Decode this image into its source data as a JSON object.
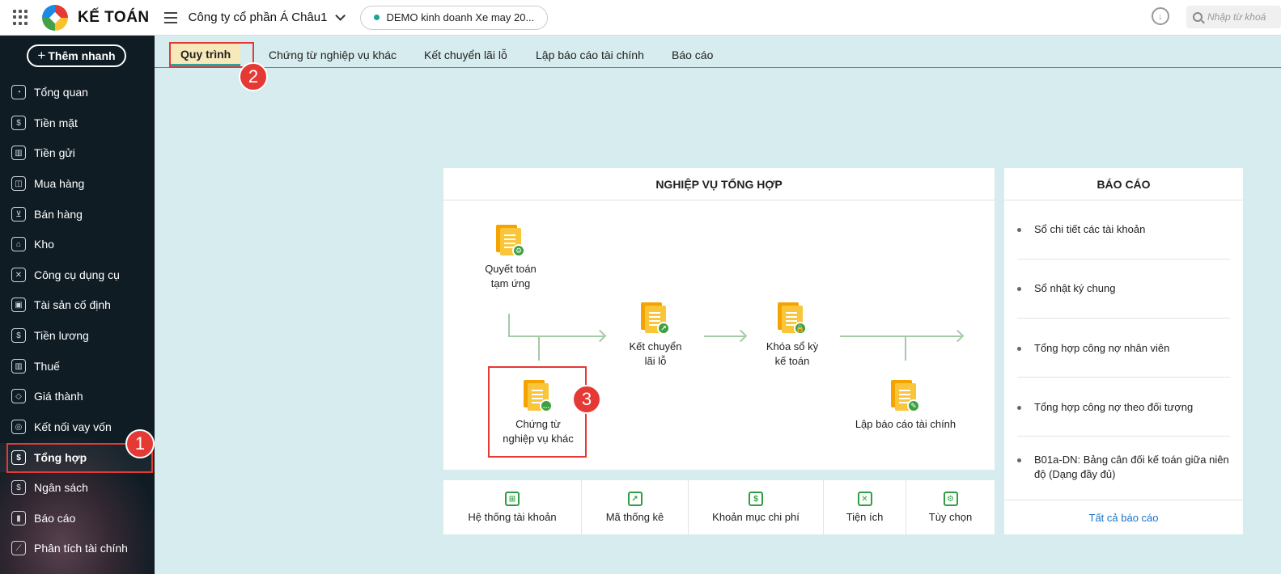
{
  "app": {
    "name": "KẾ TOÁN"
  },
  "header": {
    "company": "Công ty cổ phần Á Châu1",
    "database": "DEMO kinh doanh Xe may 20...",
    "search_placeholder": "Nhập từ khoá"
  },
  "sidebar": {
    "quick_add": "Thêm nhanh",
    "items": [
      {
        "label": "Tổng quan",
        "icon": "pie-chart-icon"
      },
      {
        "label": "Tiền mặt",
        "icon": "money-bag-icon"
      },
      {
        "label": "Tiền gửi",
        "icon": "bank-icon"
      },
      {
        "label": "Mua hàng",
        "icon": "shopping-bag-icon"
      },
      {
        "label": "Bán hàng",
        "icon": "cart-icon"
      },
      {
        "label": "Kho",
        "icon": "warehouse-icon"
      },
      {
        "label": "Công cụ dụng cụ",
        "icon": "tools-icon"
      },
      {
        "label": "Tài sản cố định",
        "icon": "car-icon"
      },
      {
        "label": "Tiền lương",
        "icon": "payroll-icon"
      },
      {
        "label": "Thuế",
        "icon": "tax-building-icon"
      },
      {
        "label": "Giá thành",
        "icon": "price-tag-icon"
      },
      {
        "label": "Kết nối vay vốn",
        "icon": "loan-icon"
      },
      {
        "label": "Tổng hợp",
        "icon": "ledger-icon"
      },
      {
        "label": "Ngân sách",
        "icon": "budget-icon"
      },
      {
        "label": "Báo cáo",
        "icon": "bar-chart-icon"
      },
      {
        "label": "Phân tích tài chính",
        "icon": "line-chart-icon"
      }
    ]
  },
  "tabs": [
    {
      "label": "Quy trình"
    },
    {
      "label": "Chứng từ nghiệp vụ khác"
    },
    {
      "label": "Kết chuyển lãi lỗ"
    },
    {
      "label": "Lập báo cáo tài chính"
    },
    {
      "label": "Báo cáo"
    }
  ],
  "workflow": {
    "title": "NGHIỆP VỤ TỔNG HỢP",
    "nodes": {
      "settle": {
        "line1": "Quyết toán",
        "line2": "tạm ứng"
      },
      "other_docs": {
        "line1": "Chứng từ",
        "line2": "nghiệp vụ khác"
      },
      "transfer": {
        "line1": "Kết chuyển",
        "line2": "lãi lỗ"
      },
      "lock": {
        "line1": "Khóa sổ kỳ",
        "line2": "kế toán"
      },
      "fin_report": {
        "line1": "Lập báo cáo tài chính"
      }
    }
  },
  "tools": [
    {
      "label": "Hệ thống tài khoản"
    },
    {
      "label": "Mã thống kê"
    },
    {
      "label": "Khoản mục chi phí"
    },
    {
      "label": "Tiện ích"
    },
    {
      "label": "Tùy chọn"
    }
  ],
  "reports": {
    "title": "BÁO CÁO",
    "items": [
      "Sổ chi tiết các tài khoản",
      "Sổ nhật ký chung",
      "Tổng hợp công nợ nhân viên",
      "Tổng hợp công nợ theo đối tượng",
      "B01a-DN: Bảng cân đối kế toán giữa niên độ (Dạng đầy đủ)"
    ],
    "all_link": "Tất cả báo cáo"
  },
  "annotations": {
    "badge1": "1",
    "badge2": "2",
    "badge3": "3"
  },
  "colors": {
    "accent": "#2aa3a0",
    "sidebar": "#0f1c24",
    "highlight": "#e53935"
  }
}
